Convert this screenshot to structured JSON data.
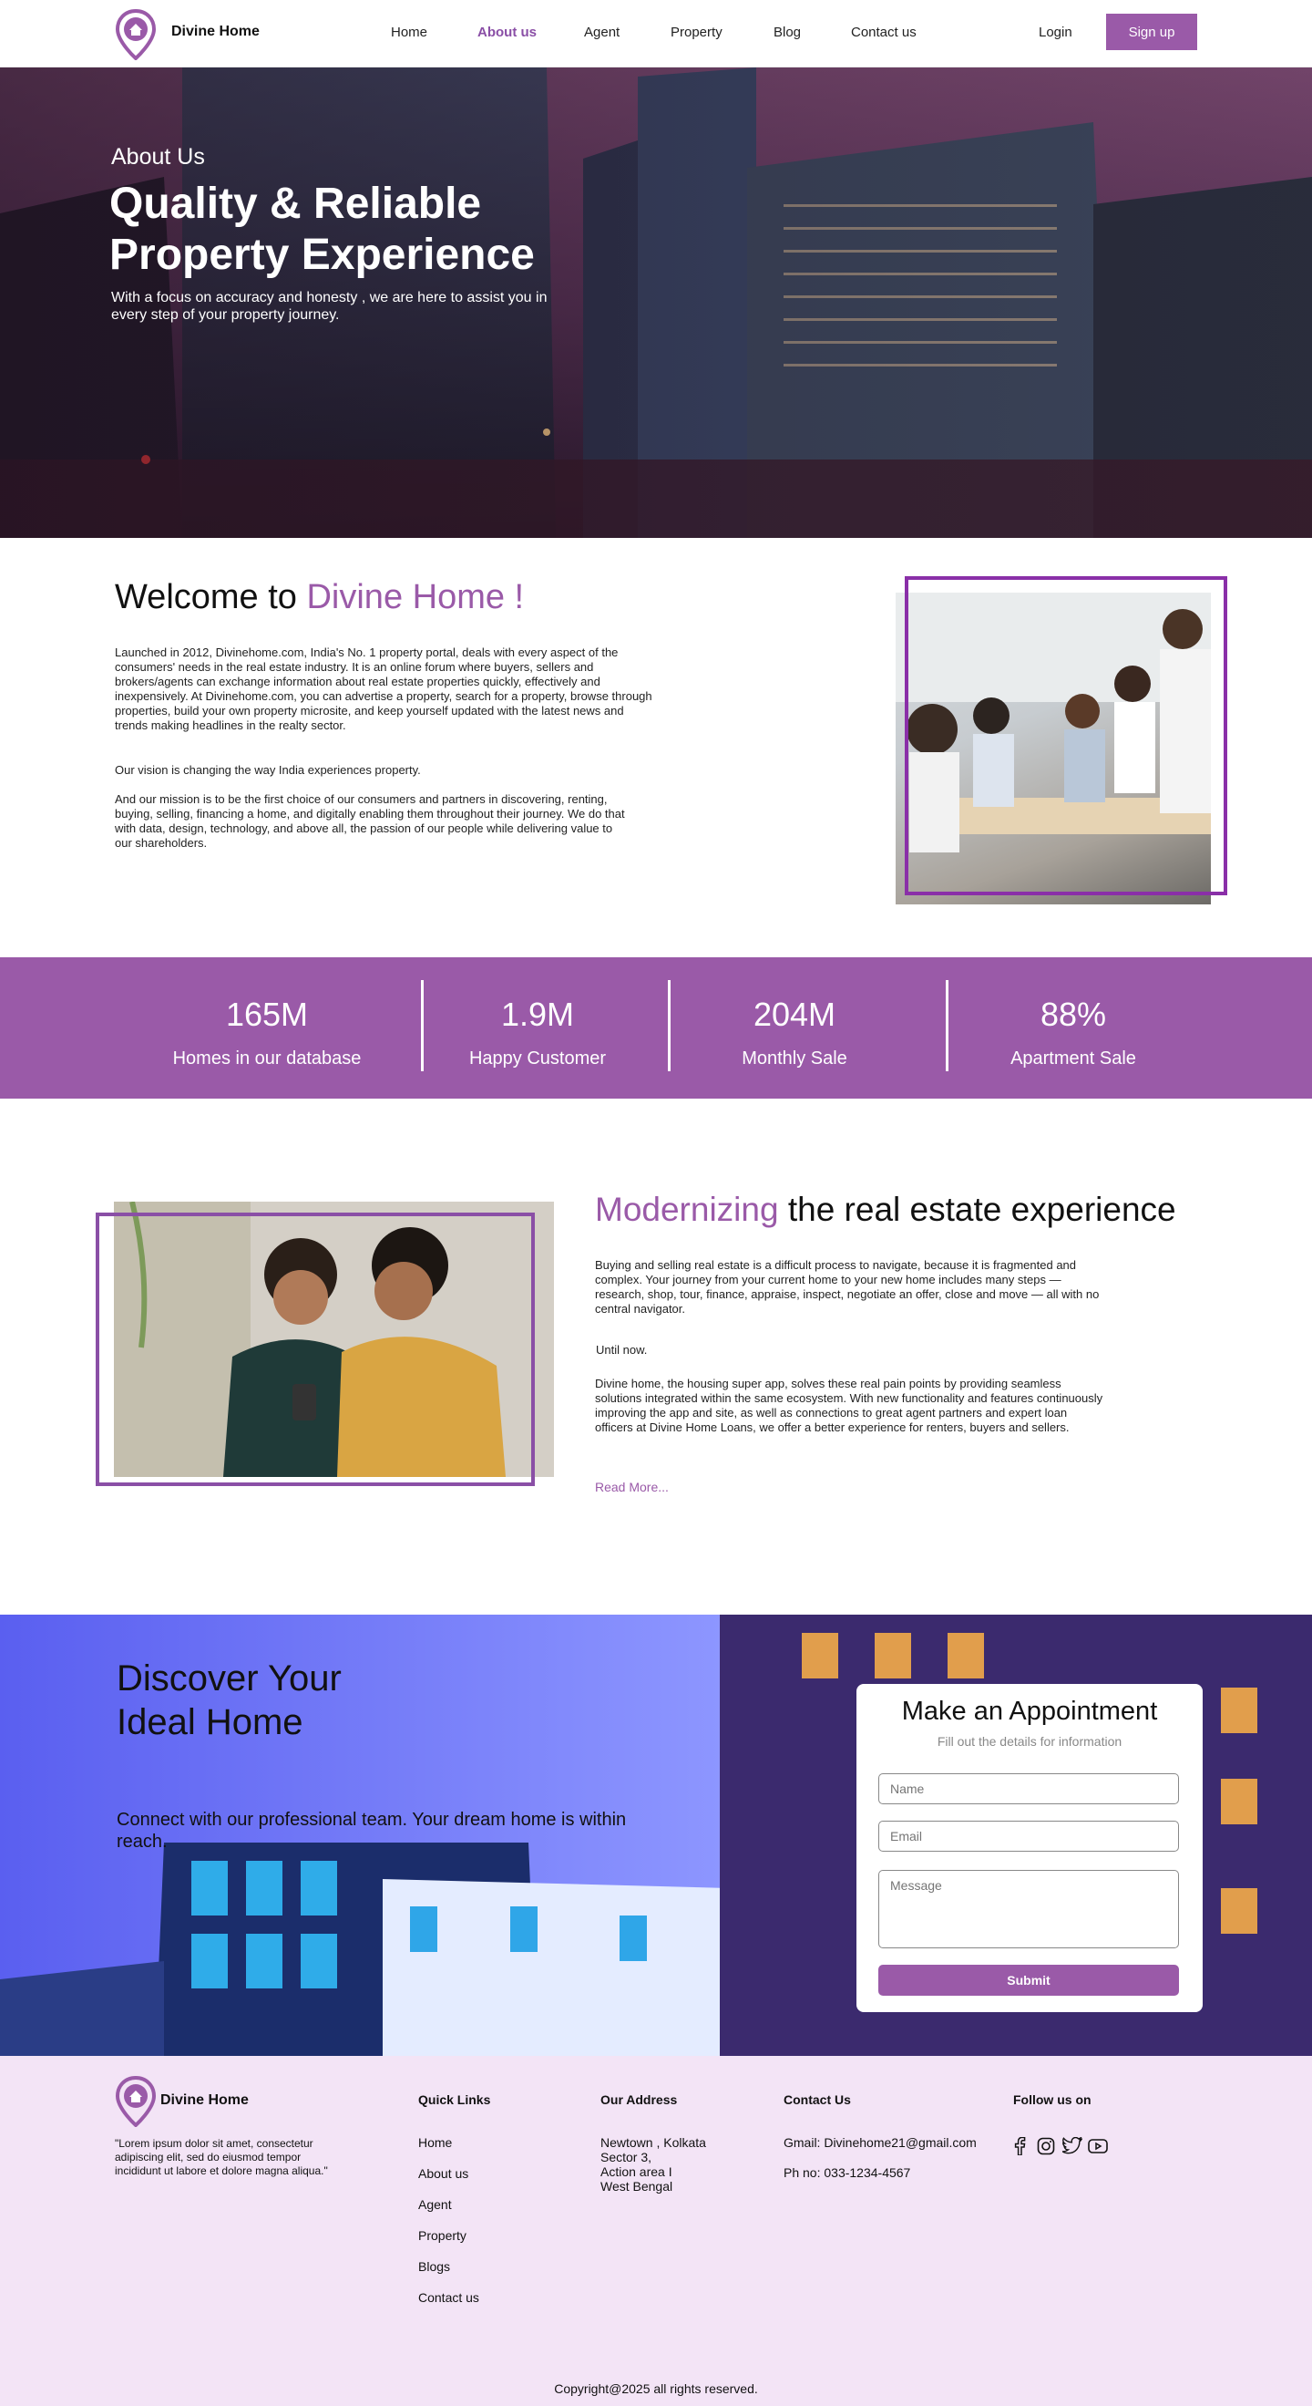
{
  "brand": {
    "name": "Divine Home",
    "accent_color": "#9a5aa8"
  },
  "nav": {
    "links": [
      "Home",
      "About us",
      "Agent",
      "Property",
      "Blog",
      "Contact us"
    ],
    "active": "About us",
    "login_label": "Login",
    "signup_label": "Sign up"
  },
  "hero": {
    "subtitle": "About Us",
    "title": "Quality & Reliable Property Experience",
    "text": "With a focus on accuracy and honesty , we are here to assist you in every step of your property journey."
  },
  "welcome": {
    "title_prefix": "Welcome to ",
    "title_accent": "Divine Home !",
    "p1": "Launched in 2012, Divinehome.com, India's No. 1 property portal, deals with every aspect of the consumers' needs in the real estate industry. It is an online forum where buyers, sellers and brokers/agents can exchange information about real estate properties quickly, effectively and inexpensively. At Divinehome.com, you can advertise a property, search for a property, browse through properties, build your own property microsite, and keep yourself updated with the latest news and trends making headlines in the realty sector.",
    "p2": "Our vision is changing the way India experiences property.",
    "p3": "And our mission is to be the first choice of our consumers and partners in discovering, renting, buying, selling, financing a home, and digitally enabling them throughout their journey. We do that with data, design, technology, and above all, the passion of our people while delivering value to our shareholders."
  },
  "stats": [
    {
      "value": "165M",
      "label": "Homes in our database"
    },
    {
      "value": "1.9M",
      "label": "Happy Customer"
    },
    {
      "value": "204M",
      "label": "Monthly Sale"
    },
    {
      "value": "88%",
      "label": "Apartment Sale"
    }
  ],
  "modern": {
    "title_accent": "Modernizing",
    "title_rest": " the real estate experience",
    "p1": "Buying and selling real estate is a difficult process to navigate, because it is fragmented and complex. Your journey from your current home to your new home includes many steps — research, shop, tour, finance, appraise, inspect, negotiate an offer, close and move — all with no central navigator.",
    "p2": "Until now.",
    "p3": "Divine home, the housing super app, solves these real pain points by providing seamless solutions integrated within the same ecosystem. With new functionality and features continuously improving the app and site, as well as connections to great agent partners and expert loan officers at Divine Home Loans, we offer a better experience for renters, buyers and sellers.",
    "read_more": "Read More..."
  },
  "discover": {
    "title": "Discover Your Ideal Home",
    "text": "Connect with our professional team. Your dream home is within reach."
  },
  "appointment": {
    "title": "Make an Appointment",
    "subtitle": "Fill out the details for information",
    "name_placeholder": "Name",
    "email_placeholder": "Email",
    "message_placeholder": "Message",
    "submit_label": "Submit"
  },
  "footer": {
    "brand": "Divine Home",
    "quote": "\"Lorem ipsum dolor sit amet, consectetur adipiscing elit, sed do eiusmod tempor incididunt ut labore et dolore magna aliqua.\"",
    "quick_links_title": "Quick Links",
    "quick_links": [
      "Home",
      "About us",
      "Agent",
      "Property",
      "Blogs",
      "Contact us"
    ],
    "address_title": "Our Address",
    "address_lines": [
      "Newtown , Kolkata",
      "Sector 3,",
      "Action area I",
      "West Bengal"
    ],
    "contact_title": "Contact Us",
    "email": "Gmail: Divinehome21@gmail.com",
    "phone": "Ph no: 033-1234-4567",
    "follow_title": "Follow us on",
    "social_icons": [
      "facebook-icon",
      "instagram-icon",
      "twitter-icon",
      "youtube-icon"
    ],
    "copyright": "Copyright@2025 all rights reserved."
  }
}
